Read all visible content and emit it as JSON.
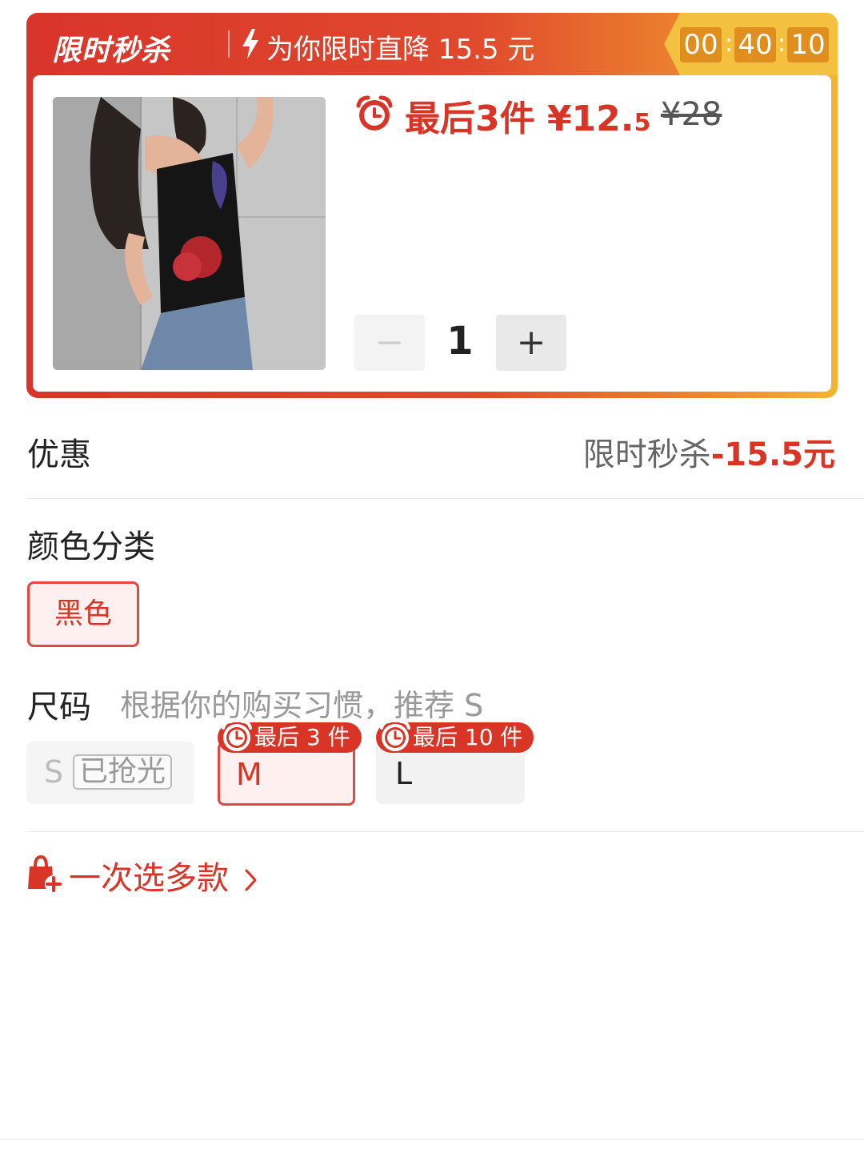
{
  "flash_sale": {
    "title": "限时秒杀",
    "description": "为你限时直降 15.5 元",
    "timer": {
      "hours": "00",
      "minutes": "40",
      "seconds": "10"
    }
  },
  "product": {
    "stock_price_text": "最后3件 ¥12.",
    "price_decimal": "5",
    "original_price": "¥28",
    "quantity": "1",
    "minus_label": "−",
    "plus_label": "+"
  },
  "promotion": {
    "label": "优惠",
    "name": "限时秒杀",
    "amount": "-15.5元"
  },
  "color": {
    "label": "颜色分类",
    "options": [
      "黑色"
    ],
    "selected": "黑色"
  },
  "size": {
    "label": "尺码",
    "hint": "根据你的购买习惯，推荐 S",
    "options": [
      {
        "name": "S",
        "status": "已抢光"
      },
      {
        "name": "M",
        "badge": "最后 3 件"
      },
      {
        "name": "L",
        "badge": "最后 10 件"
      }
    ],
    "selected": "M"
  },
  "multi_select": {
    "label": "一次选多款"
  },
  "colors": {
    "accent": "#d93527",
    "timer_bg": "#f4c040"
  }
}
